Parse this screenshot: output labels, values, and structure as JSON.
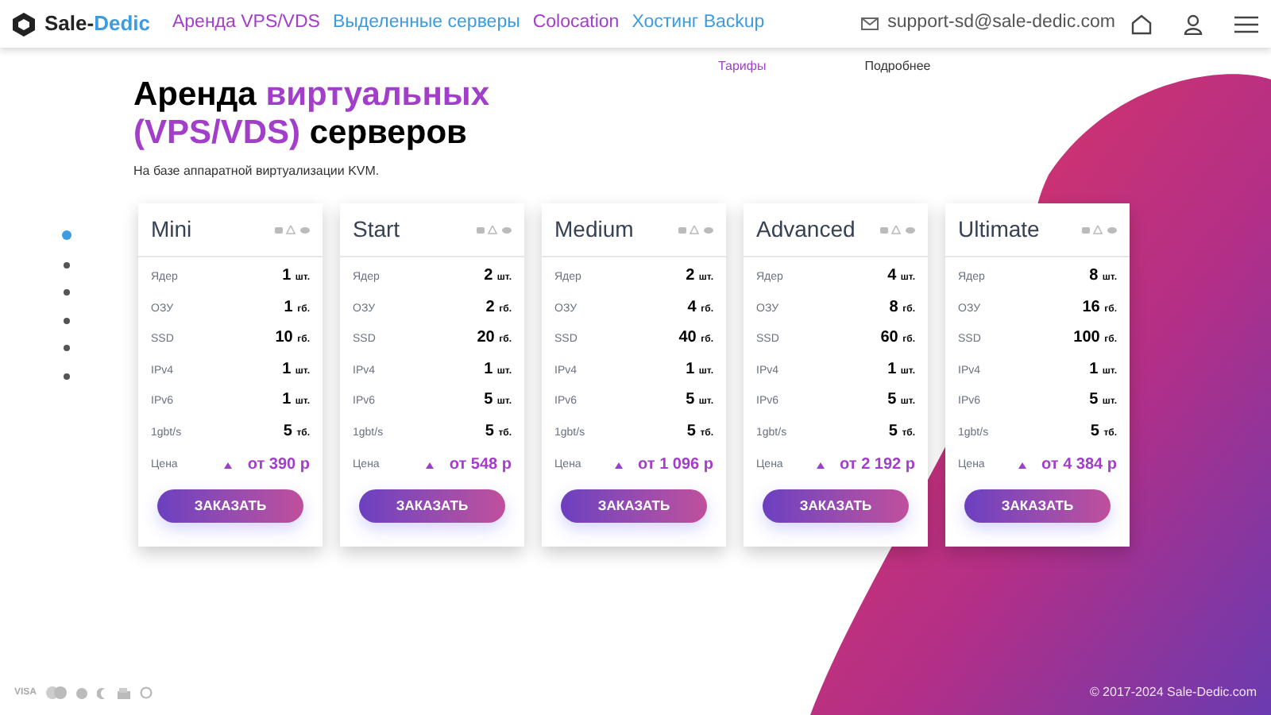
{
  "header": {
    "logo_text": "Sale-",
    "logo_accent": "Dedic",
    "nav": [
      {
        "label": "Аренда VPS/VDS",
        "color": "#a23ec9"
      },
      {
        "label": "Выделенные серверы",
        "color": "#3d9be0"
      },
      {
        "label": "Colocation",
        "color": "#a23ec9"
      },
      {
        "label": "Хостинг Backup",
        "color": "#3d9be0"
      }
    ],
    "email": "support-sd@sale-dedic.com"
  },
  "subnav": [
    {
      "label": "Тарифы",
      "selected": true
    },
    {
      "label": "Подробнее",
      "selected": false
    }
  ],
  "hero": {
    "title_plain": "Аренда ",
    "title_accent": "виртуальных (VPS/VDS)",
    "title_end": " серверов",
    "subtitle": "На базе аппаратной виртуализации KVM."
  },
  "side_dots": [
    {
      "selected": true
    },
    {
      "selected": false
    },
    {
      "selected": false
    },
    {
      "selected": false
    },
    {
      "selected": false
    },
    {
      "selected": false
    }
  ],
  "plans": [
    {
      "name": "Mini",
      "specs": [
        {
          "label": "Ядер",
          "value": "1",
          "unit": "шт."
        },
        {
          "label": "ОЗУ",
          "value": "1",
          "unit": "гб."
        },
        {
          "label": "SSD",
          "value": "10",
          "unit": "гб."
        },
        {
          "label": "IPv4",
          "value": "1",
          "unit": "шт."
        },
        {
          "label": "IPv6",
          "value": "1",
          "unit": "шт."
        },
        {
          "label": "1gbt/s",
          "value": "5",
          "unit": "тб."
        }
      ],
      "price_label": "Цена",
      "price": "от 390 р",
      "button": "ЗАКАЗАТЬ"
    },
    {
      "name": "Start",
      "specs": [
        {
          "label": "Ядер",
          "value": "2",
          "unit": "шт."
        },
        {
          "label": "ОЗУ",
          "value": "2",
          "unit": "гб."
        },
        {
          "label": "SSD",
          "value": "20",
          "unit": "гб."
        },
        {
          "label": "IPv4",
          "value": "1",
          "unit": "шт."
        },
        {
          "label": "IPv6",
          "value": "5",
          "unit": "шт."
        },
        {
          "label": "1gbt/s",
          "value": "5",
          "unit": "тб."
        }
      ],
      "price_label": "Цена",
      "price": "от 548 р",
      "button": "ЗАКАЗАТЬ"
    },
    {
      "name": "Medium",
      "specs": [
        {
          "label": "Ядер",
          "value": "2",
          "unit": "шт."
        },
        {
          "label": "ОЗУ",
          "value": "4",
          "unit": "гб."
        },
        {
          "label": "SSD",
          "value": "40",
          "unit": "гб."
        },
        {
          "label": "IPv4",
          "value": "1",
          "unit": "шт."
        },
        {
          "label": "IPv6",
          "value": "5",
          "unit": "шт."
        },
        {
          "label": "1gbt/s",
          "value": "5",
          "unit": "тб."
        }
      ],
      "price_label": "Цена",
      "price": "от 1 096 р",
      "button": "ЗАКАЗАТЬ"
    },
    {
      "name": "Advanced",
      "specs": [
        {
          "label": "Ядер",
          "value": "4",
          "unit": "шт."
        },
        {
          "label": "ОЗУ",
          "value": "8",
          "unit": "гб."
        },
        {
          "label": "SSD",
          "value": "60",
          "unit": "гб."
        },
        {
          "label": "IPv4",
          "value": "1",
          "unit": "шт."
        },
        {
          "label": "IPv6",
          "value": "5",
          "unit": "шт."
        },
        {
          "label": "1gbt/s",
          "value": "5",
          "unit": "тб."
        }
      ],
      "price_label": "Цена",
      "price": "от 2 192 р",
      "button": "ЗАКАЗАТЬ"
    },
    {
      "name": "Ultimate",
      "specs": [
        {
          "label": "Ядер",
          "value": "8",
          "unit": "шт."
        },
        {
          "label": "ОЗУ",
          "value": "16",
          "unit": "гб."
        },
        {
          "label": "SSD",
          "value": "100",
          "unit": "гб."
        },
        {
          "label": "IPv4",
          "value": "1",
          "unit": "шт."
        },
        {
          "label": "IPv6",
          "value": "5",
          "unit": "шт."
        },
        {
          "label": "1gbt/s",
          "value": "5",
          "unit": "тб."
        }
      ],
      "price_label": "Цена",
      "price": "от 4 384 р",
      "button": "ЗАКАЗАТЬ"
    }
  ],
  "footer": {
    "visa": "VISA",
    "copyright": "© 2017-2024 Sale-Dedic.com"
  }
}
